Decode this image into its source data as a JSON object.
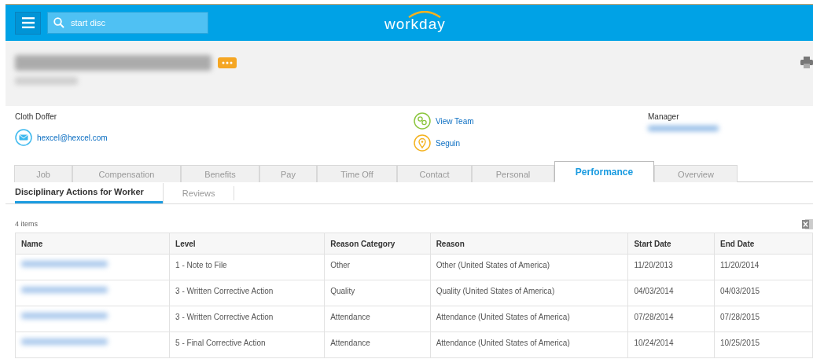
{
  "top_bar": {
    "search": {
      "value": "start disc"
    },
    "logo": "workday"
  },
  "worker": {
    "job_title": "Cloth Doffer",
    "email": "hexcel@hexcel.com",
    "links": [
      {
        "kind": "team",
        "label": "View Team"
      },
      {
        "kind": "location",
        "label": "Seguin"
      }
    ],
    "manager_label": "Manager"
  },
  "tabs": [
    {
      "label": "Job",
      "selected": false
    },
    {
      "label": "Compensation",
      "selected": false
    },
    {
      "label": "Benefits",
      "selected": false
    },
    {
      "label": "Pay",
      "selected": false
    },
    {
      "label": "Time Off",
      "selected": false
    },
    {
      "label": "Contact",
      "selected": false
    },
    {
      "label": "Personal",
      "selected": false
    },
    {
      "label": "Performance",
      "selected": true
    },
    {
      "label": "Overview",
      "selected": false
    }
  ],
  "subtabs": [
    {
      "label": "Disciplinary Actions for Worker",
      "selected": true
    },
    {
      "label": "Reviews",
      "selected": false
    }
  ],
  "table": {
    "count": "4 items",
    "columns": [
      "Name",
      "Level",
      "Reason Category",
      "Reason",
      "Start Date",
      "End Date"
    ],
    "rows": [
      [
        "",
        "1 - Note to File",
        "Other",
        "Other (United States of America)",
        "11/20/2013",
        "11/20/2014"
      ],
      [
        "",
        "3 - Written Corrective Action",
        "Quality",
        "Quality (United States of America)",
        "04/03/2014",
        "04/03/2015"
      ],
      [
        "",
        "3 - Written Corrective Action",
        "Attendance",
        "Attendance (United States of America)",
        "07/28/2014",
        "07/28/2015"
      ],
      [
        "",
        "5 - Final Corrective Action",
        "Attendance",
        "Attendance (United States of America)",
        "10/24/2014",
        "10/25/2015"
      ]
    ]
  }
}
